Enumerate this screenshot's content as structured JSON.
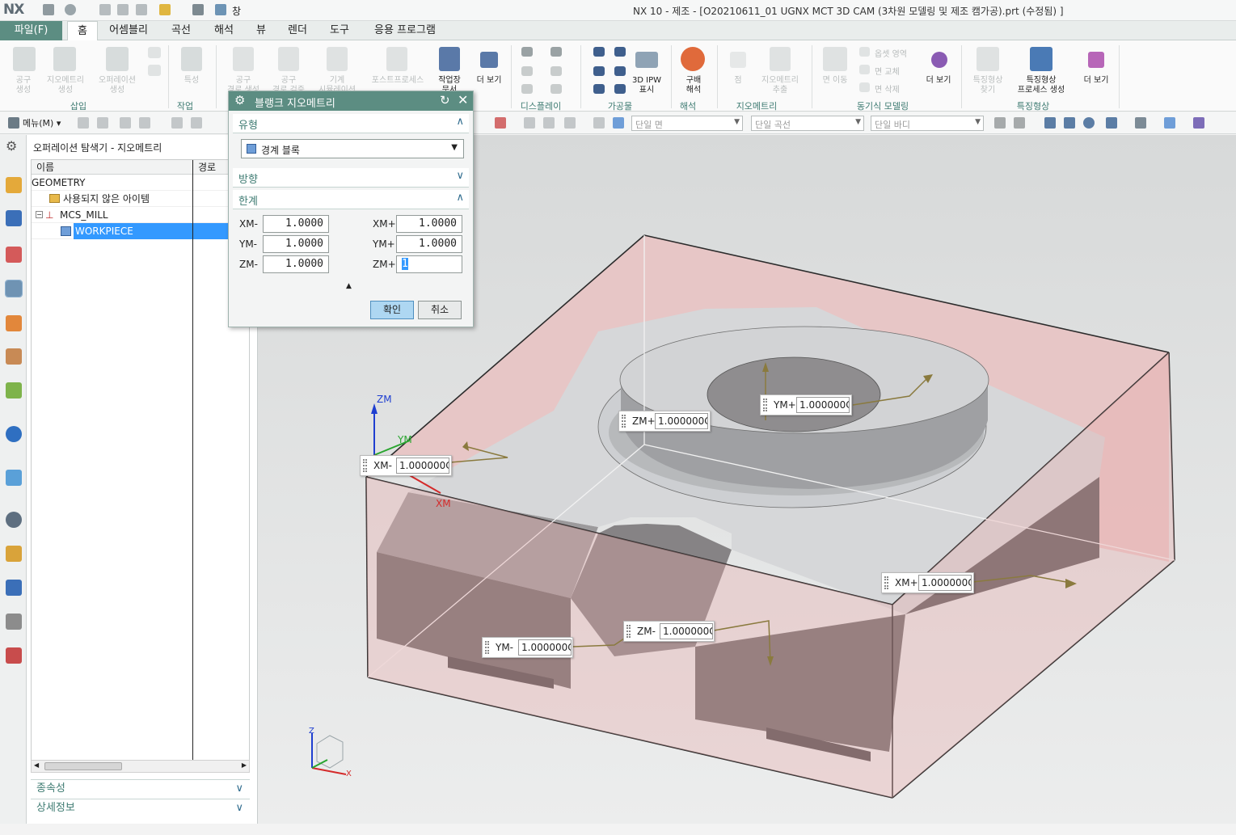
{
  "app": {
    "logo": "NX",
    "window_title": "NX 10 - 제조 - [O20210611_01 UGNX MCT 3D CAM (3차원 모델링 및 제조 캠가공).prt (수정됨) ]",
    "quick_access_window": "창"
  },
  "tabs": [
    {
      "label": "파일(F)"
    },
    {
      "label": "홈"
    },
    {
      "label": "어셈블리"
    },
    {
      "label": "곡선"
    },
    {
      "label": "해석"
    },
    {
      "label": "뷰"
    },
    {
      "label": "렌더"
    },
    {
      "label": "도구"
    },
    {
      "label": "응용 프로그램"
    }
  ],
  "ribbon": {
    "buttons": [
      {
        "label": "공구\n생성"
      },
      {
        "label": "지오메트리\n생성"
      },
      {
        "label": "오퍼레이션\n생성"
      },
      {
        "label": "특성"
      },
      {
        "label": "공구\n경로 생성"
      },
      {
        "label": "공구\n경로 검증"
      },
      {
        "label": "기계\n시뮬레이션"
      },
      {
        "label": "포스트프로세스"
      },
      {
        "label": "작업장\n문서"
      },
      {
        "label": "더 보기"
      },
      {
        "label": "3D IPW\n표시"
      },
      {
        "label": "구배\n해석"
      },
      {
        "label": "점"
      },
      {
        "label": "지오메트리\n추출"
      },
      {
        "label": "면 이동"
      },
      {
        "label": "옵셋 영역"
      },
      {
        "label": "면 교체"
      },
      {
        "label": "면 삭제"
      },
      {
        "label": "더 보기"
      },
      {
        "label": "특징형상\n찾기"
      },
      {
        "label": "특징형상\n프로세스 생성"
      },
      {
        "label": "더 보기"
      }
    ],
    "groups": [
      {
        "label": "삽입"
      },
      {
        "label": "작업"
      },
      {
        "label": "디스플레이"
      },
      {
        "label": "가공물"
      },
      {
        "label": "해석"
      },
      {
        "label": "지오메트리"
      },
      {
        "label": "동기식 모델링"
      },
      {
        "label": "특징형상"
      }
    ]
  },
  "toolbar2": {
    "menu_label": "메뉴(M)",
    "filters": [
      {
        "value": "단일 면"
      },
      {
        "value": "단일 곡선"
      },
      {
        "value": "단일 바디"
      }
    ]
  },
  "navigator": {
    "title": "오퍼레이션 탐색기 - 지오메트리",
    "columns": [
      "이름",
      "경로"
    ],
    "rows": [
      {
        "label": "GEOMETRY"
      },
      {
        "label": "사용되지 않은 아이템"
      },
      {
        "label": "MCS_MILL"
      },
      {
        "label": "WORKPIECE"
      }
    ],
    "panels": [
      {
        "label": "종속성"
      },
      {
        "label": "상세정보"
      }
    ]
  },
  "dialog": {
    "title": "블랭크 지오메트리",
    "sections": {
      "type": "유형",
      "direction": "방향",
      "limits": "한계"
    },
    "type_value": "경계 블록",
    "limits": [
      {
        "label": "XM-",
        "value": "1.0000"
      },
      {
        "label": "XM+",
        "value": "1.0000"
      },
      {
        "label": "YM-",
        "value": "1.0000"
      },
      {
        "label": "YM+",
        "value": "1.0000"
      },
      {
        "label": "ZM-",
        "value": "1.0000"
      },
      {
        "label": "ZM+",
        "value": "1"
      }
    ],
    "ok_label": "확인",
    "cancel_label": "취소"
  },
  "viewport": {
    "axis_labels": {
      "zm": "ZM",
      "ym": "YM",
      "xm": "XM",
      "z": "Z",
      "x": "X"
    },
    "handles": [
      {
        "label": "ZM+",
        "value": "1.000000C"
      },
      {
        "label": "YM+",
        "value": "1.000000C"
      },
      {
        "label": "XM-",
        "value": "1.000000C"
      },
      {
        "label": "XM+",
        "value": "1.000000C"
      },
      {
        "label": "ZM-",
        "value": "1.000000C"
      },
      {
        "label": "YM-",
        "value": "1.000000C"
      }
    ]
  },
  "colors": {
    "accent": "#5c8d82",
    "accent_text": "#3e7b72",
    "selection": "#3399ff",
    "blank_box": "#e8b3b3",
    "part_top": "#d6d7d9",
    "part_side": "#6d6a6b"
  },
  "icons": [
    "save-icon",
    "undo-icon",
    "cut-icon",
    "copy-icon",
    "paste-icon",
    "window-icon",
    "settings-icon",
    "refresh-icon",
    "close-icon",
    "chevron-up-icon",
    "chevron-down-icon"
  ]
}
